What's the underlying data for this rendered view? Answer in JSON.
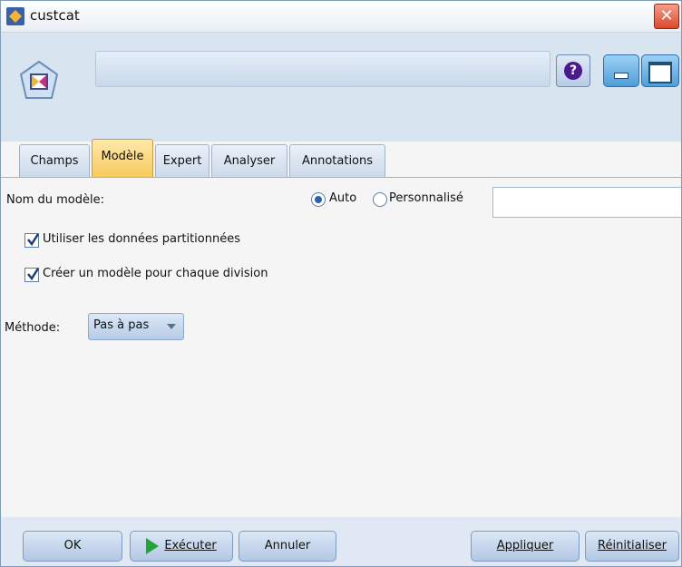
{
  "window": {
    "title": "custcat"
  },
  "tabs": [
    {
      "label": "Champs",
      "active": false
    },
    {
      "label": "Modèle",
      "active": true
    },
    {
      "label": "Expert",
      "active": false
    },
    {
      "label": "Analyser",
      "active": false
    },
    {
      "label": "Annotations",
      "active": false
    }
  ],
  "model": {
    "name_label": "Nom du modèle:",
    "name_mode_auto": "Auto",
    "name_mode_custom": "Personnalisé",
    "selected_mode": "Auto",
    "custom_name_value": ""
  },
  "options": {
    "use_partitioned": {
      "label": "Utiliser les données partitionnées",
      "checked": true
    },
    "model_per_split": {
      "label": "Créer un modèle pour chaque division",
      "checked": true
    }
  },
  "method": {
    "label": "Méthode:",
    "value": "Pas à pas"
  },
  "footer": {
    "ok": "OK",
    "run": "Exécuter",
    "cancel": "Annuler",
    "apply": "Appliquer",
    "reset": "Réinitialiser"
  },
  "colors": {
    "accent": "#2a62b0",
    "active_tab": "#f7c95d",
    "run_icon": "#23a338",
    "close": "#d9492d"
  },
  "icons": [
    "node-diamond-icon",
    "help-icon",
    "minimize-icon",
    "maximize-icon",
    "close-icon",
    "play-icon"
  ]
}
